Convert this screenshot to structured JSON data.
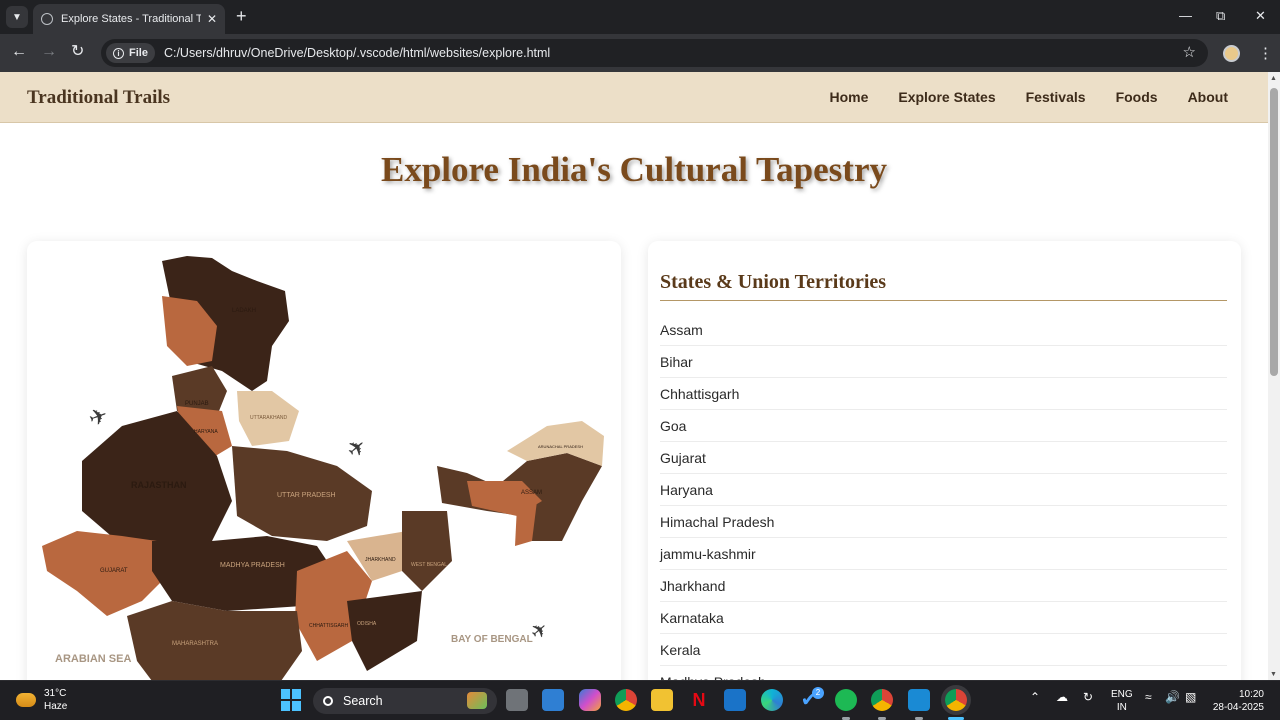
{
  "browser": {
    "tab_title": "Explore States - Traditional Trails",
    "url_chip": "File",
    "url": "C:/Users/dhruv/OneDrive/Desktop/.vscode/html/websites/explore.html"
  },
  "site": {
    "brand": "Traditional Trails",
    "nav": [
      "Home",
      "Explore States",
      "Festivals",
      "Foods",
      "About"
    ],
    "hero_title": "Explore India's Cultural Tapestry"
  },
  "map": {
    "labels": [
      "LADAKH",
      "PUNJAB",
      "HARYANA",
      "UTTARAKHAND",
      "RAJASTHAN",
      "UTTAR PRADESH",
      "GUJARAT",
      "MADHYA PRADESH",
      "CHHATTISGARH",
      "ODISHA",
      "MAHARASHTRA",
      "JHARKHAND",
      "WEST BENGAL",
      "ASSAM",
      "ARUNACHAL PRADESH",
      "ARABIAN SEA",
      "BAY OF BENGAL"
    ],
    "colors": {
      "dark": "#3b2418",
      "mid": "#5a3a26",
      "terracotta": "#b9683f",
      "light": "#d9b48f",
      "sand": "#e2c7a4"
    }
  },
  "states_panel": {
    "heading": "States & Union Territories",
    "items": [
      "Assam",
      "Bihar",
      "Chhattisgarh",
      "Goa",
      "Gujarat",
      "Haryana",
      "Himachal Pradesh",
      "jammu-kashmir",
      "Jharkhand",
      "Karnataka",
      "Kerala",
      "Madhya Pradesh"
    ]
  },
  "taskbar": {
    "weather_temp": "31°C",
    "weather_desc": "Haze",
    "search_placeholder": "Search",
    "lang_1": "ENG",
    "lang_2": "IN",
    "time": "10:20",
    "date": "28-04-2025",
    "badge_count": "2"
  }
}
